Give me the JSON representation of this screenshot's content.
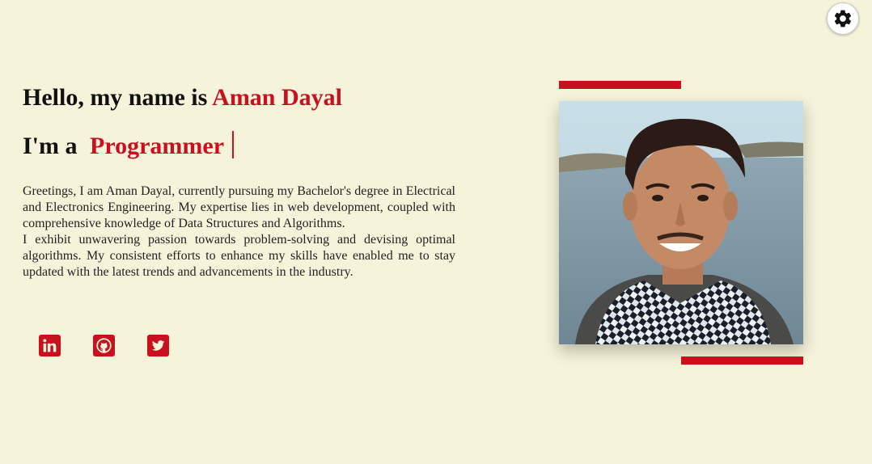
{
  "settings": {
    "icon": "gear-icon"
  },
  "hero": {
    "greeting_prefix": "Hello, my name is ",
    "name": "Aman Dayal",
    "role_prefix": "I'm a",
    "role": "Programmer",
    "bio_paragraph_1": "Greetings, I am Aman Dayal, currently pursuing my Bachelor's degree in Electrical and Electronics Engineering. My expertise lies in web development, coupled with comprehensive knowledge of Data Structures and Algorithms.",
    "bio_paragraph_2": "I exhibit unwavering passion towards problem-solving and devising optimal algorithms. My consistent efforts to enhance my skills have enabled me to stay updated with the latest trends and advancements in the industry."
  },
  "socials": [
    {
      "icon": "linkedin-icon"
    },
    {
      "icon": "github-icon"
    },
    {
      "icon": "twitter-icon"
    }
  ],
  "colors": {
    "background": "#f5f3da",
    "accent": "#c8101f"
  }
}
